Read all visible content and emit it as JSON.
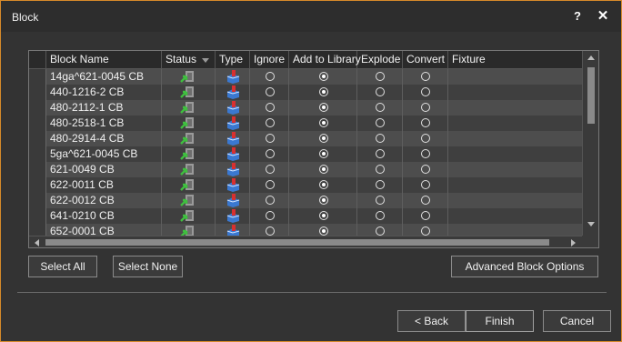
{
  "window": {
    "title": "Block",
    "help_label": "?",
    "close_label": "✕"
  },
  "colors": {
    "accent_border": "#d68a2a",
    "status_icon": "#3fbf3f",
    "type_icon_red": "#d83030",
    "type_icon_blue": "#3a78d0"
  },
  "grid": {
    "columns": [
      "Block Name",
      "Status",
      "Type",
      "Ignore",
      "Add to Library",
      "Explode",
      "Convert",
      "Fixture"
    ],
    "rows": [
      {
        "name": "14ga^621-0045 CB",
        "status_icon": "inserted-block-icon",
        "type_icon": "block-type-icon",
        "selected_option": "Add to Library"
      },
      {
        "name": "440-1216-2 CB",
        "status_icon": "inserted-block-icon",
        "type_icon": "block-type-icon",
        "selected_option": "Add to Library"
      },
      {
        "name": "480-2112-1 CB",
        "status_icon": "inserted-block-icon",
        "type_icon": "block-type-icon",
        "selected_option": "Add to Library"
      },
      {
        "name": "480-2518-1 CB",
        "status_icon": "inserted-block-icon",
        "type_icon": "block-type-icon",
        "selected_option": "Add to Library"
      },
      {
        "name": "480-2914-4 CB",
        "status_icon": "inserted-block-icon",
        "type_icon": "block-type-icon",
        "selected_option": "Add to Library"
      },
      {
        "name": "5ga^621-0045 CB",
        "status_icon": "inserted-block-icon",
        "type_icon": "block-type-icon",
        "selected_option": "Add to Library"
      },
      {
        "name": "621-0049 CB",
        "status_icon": "inserted-block-icon",
        "type_icon": "block-type-icon",
        "selected_option": "Add to Library"
      },
      {
        "name": "622-0011 CB",
        "status_icon": "inserted-block-icon",
        "type_icon": "block-type-icon",
        "selected_option": "Add to Library"
      },
      {
        "name": "622-0012 CB",
        "status_icon": "inserted-block-icon",
        "type_icon": "block-type-icon",
        "selected_option": "Add to Library"
      },
      {
        "name": "641-0210 CB",
        "status_icon": "inserted-block-icon",
        "type_icon": "block-type-icon",
        "selected_option": "Add to Library"
      },
      {
        "name": "652-0001 CB",
        "status_icon": "inserted-block-icon",
        "type_icon": "block-type-icon",
        "selected_option": "Add to Library"
      }
    ]
  },
  "buttons": {
    "select_all": "Select All",
    "select_none": "Select None",
    "advanced": "Advanced Block Options",
    "back": "< Back",
    "finish": "Finish",
    "cancel": "Cancel"
  }
}
